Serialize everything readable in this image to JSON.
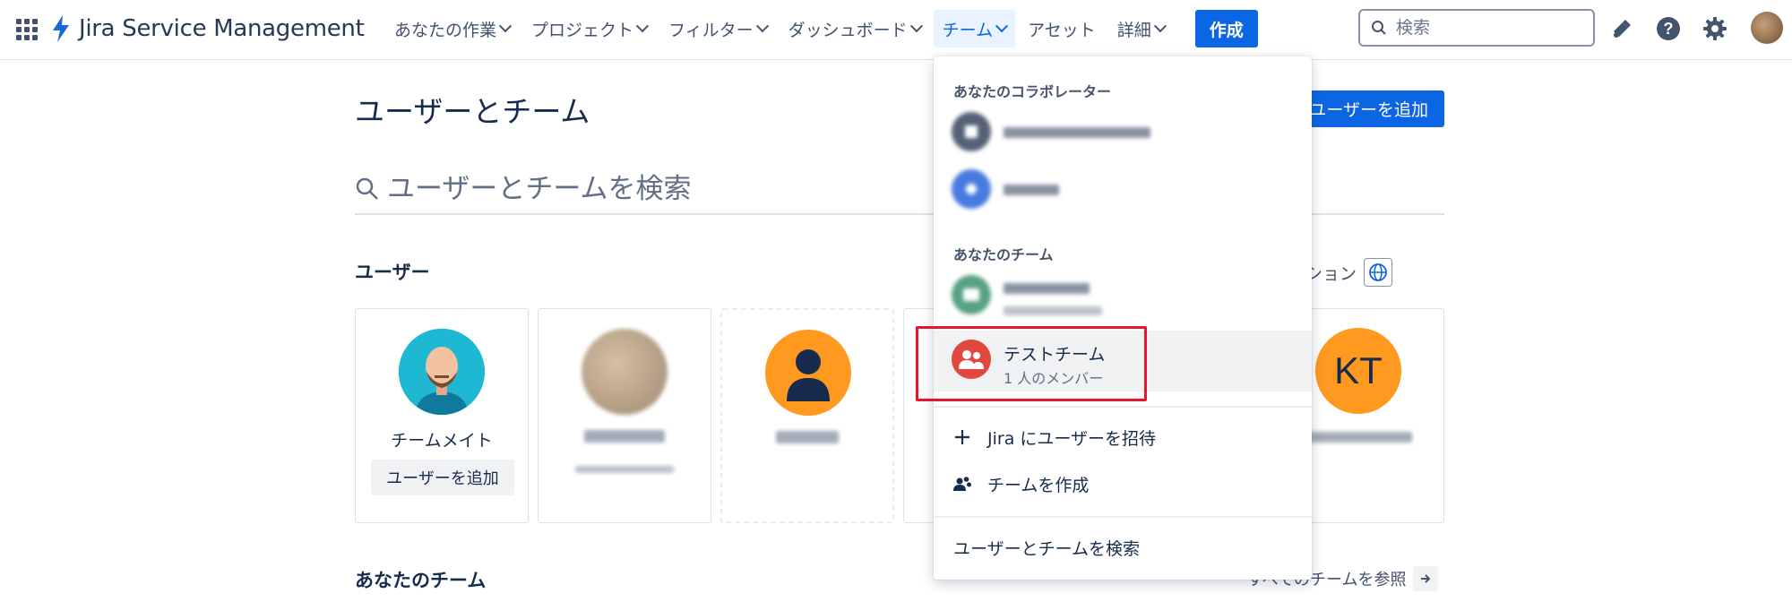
{
  "header": {
    "app_name": "Jira Service Management",
    "nav": [
      {
        "label": "あなたの作業",
        "has_menu": true
      },
      {
        "label": "プロジェクト",
        "has_menu": true
      },
      {
        "label": "フィルター",
        "has_menu": true
      },
      {
        "label": "ダッシュボード",
        "has_menu": true
      },
      {
        "label": "チーム",
        "has_menu": true,
        "active": true
      },
      {
        "label": "アセット",
        "has_menu": false
      },
      {
        "label": "詳細",
        "has_menu": true
      }
    ],
    "create_label": "作成",
    "search_placeholder": "検索",
    "icons": [
      "app-switcher-icon",
      "notifications-icon",
      "help-icon",
      "settings-icon"
    ]
  },
  "page": {
    "title": "ユーザーとチーム",
    "add_user_label": "ユーザーを追加",
    "search_placeholder": "ユーザーとチームを検索",
    "users_heading": "ユーザー",
    "search_options_label": "索オプション",
    "users": [
      {
        "name": "チームメイト",
        "action": "ユーザーを追加"
      },
      {
        "name": "",
        "blurred": true
      },
      {
        "name": "",
        "blurred": true
      },
      {
        "name": "",
        "hidden": true
      },
      {
        "name": "",
        "initials": "KT",
        "blurred": true
      }
    ],
    "teams_heading": "あなたのチーム",
    "view_all_teams_label": "すべてのチームを参照"
  },
  "teams_menu": {
    "collaborators_heading": "あなたのコラボレーター",
    "collaborators": [
      {
        "name": ""
      },
      {
        "name": ""
      }
    ],
    "your_teams_heading": "あなたのチーム",
    "teams": [
      {
        "name": "",
        "members": "",
        "blurred": true
      },
      {
        "name": "テストチーム",
        "members": "1 人のメンバー",
        "selected": true
      }
    ],
    "invite_label": "Jira にユーザーを招待",
    "create_team_label": "チームを作成",
    "search_label": "ユーザーとチームを検索"
  },
  "colors": {
    "primary": "#0c66e4",
    "highlight": "#e5172b",
    "kt_avatar": "#ff991f",
    "test_team_avatar": "#e2483d"
  }
}
